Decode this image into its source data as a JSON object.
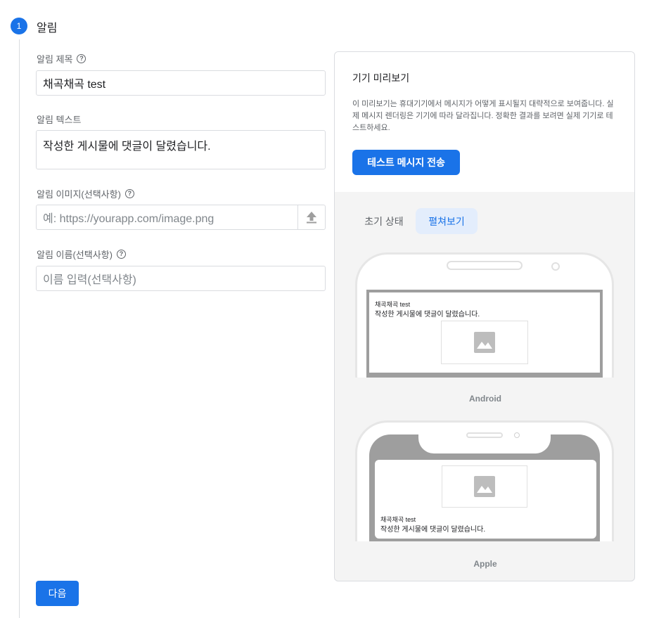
{
  "step": {
    "number": "1",
    "title": "알림"
  },
  "form": {
    "title_label": "알림 제목",
    "title_value": "채곡채곡 test",
    "text_label": "알림 텍스트",
    "text_value": "작성한 게시물에 댓글이 달렸습니다.",
    "image_label": "알림 이미지(선택사항)",
    "image_placeholder": "예: https://yourapp.com/image.png",
    "name_label": "알림 이름(선택사항)",
    "name_placeholder": "이름 입력(선택사항)",
    "help_glyph": "?",
    "help_icon": "help-circle-icon",
    "upload_icon": "upload-icon",
    "next_label": "다음"
  },
  "preview": {
    "title": "기기 미리보기",
    "description": "이 미리보기는 휴대기기에서 메시지가 어떻게 표시될지 대략적으로 보여줍니다. 실제 메시지 렌더링은 기기에 따라 달라집니다. 정확한 결과를 보려면 실제 기기로 테스트하세요.",
    "test_button": "테스트 메시지 전송",
    "tabs": [
      {
        "label": "초기 상태",
        "selected": false
      },
      {
        "label": "펼쳐보기",
        "selected": true
      }
    ],
    "android": {
      "label": "Android",
      "notif_title": "채곡채곡 test",
      "notif_body": "작성한 게시물에 댓글이 달렸습니다.",
      "image_icon": "image-placeholder-icon"
    },
    "apple": {
      "label": "Apple",
      "notif_title": "채곡채곡 test",
      "notif_body": "작성한 게시물에 댓글이 달렸습니다.",
      "image_icon": "image-placeholder-icon"
    }
  },
  "colors": {
    "accent": "#1a73e8",
    "selected_tab_bg": "#e3edfc",
    "panel_bg": "#f4f4f4",
    "phone_frame": "#9e9e9e"
  }
}
